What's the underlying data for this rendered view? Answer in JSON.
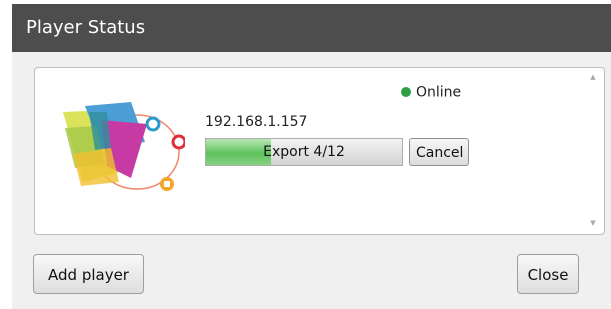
{
  "window": {
    "title": "Player Status"
  },
  "player": {
    "status": "Online",
    "status_color": "#2ea043",
    "ip_address": "192.168.1.157",
    "export_label": "Export 4/12",
    "export_progress": 0.33,
    "cancel_label": "Cancel",
    "logo_icon": "player-app-logo-icon"
  },
  "footer": {
    "add_label": "Add player",
    "close_label": "Close"
  }
}
